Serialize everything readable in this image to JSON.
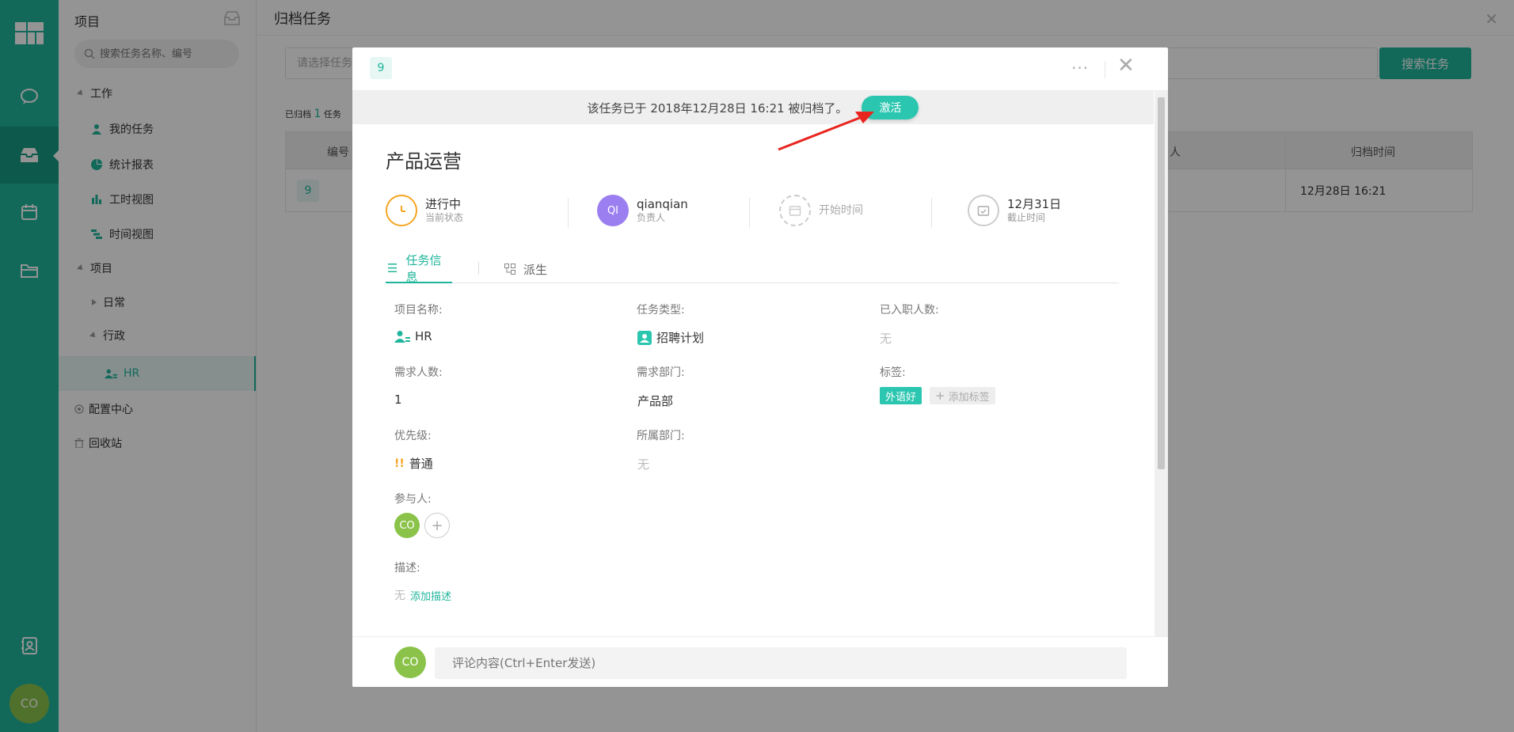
{
  "rail": {
    "avatar": "CO"
  },
  "sidebar": {
    "title": "项目",
    "search_placeholder": "搜索任务名称、编号",
    "work_group": "工作",
    "my_tasks": "我的任务",
    "stats": "统计报表",
    "hours_view": "工时视图",
    "time_view": "时间视图",
    "project_group": "项目",
    "daily": "日常",
    "admin": "行政",
    "hr": "HR",
    "config": "配置中心",
    "recycle": "回收站"
  },
  "main": {
    "title": "归档任务",
    "filter_placeholder": "请选择任务",
    "search_button": "搜索任务",
    "archived_prefix": "已归档",
    "archived_count": "1",
    "archived_suffix": "任务",
    "columns": {
      "id": "编号",
      "person": "人",
      "archived_time": "归档时间"
    },
    "row": {
      "id": "9",
      "archived_time": "12月28日 16:21"
    }
  },
  "modal": {
    "task_id": "9",
    "more": "···",
    "banner_text": "该任务已于 2018年12月28日 16:21 被归档了。",
    "activate_button": "激活",
    "title": "产品运营",
    "status": {
      "value": "进行中",
      "label": "当前状态"
    },
    "owner": {
      "initials": "QI",
      "value": "qianqian",
      "label": "负责人"
    },
    "start": {
      "label": "开始时间"
    },
    "due": {
      "value": "12月31日",
      "label": "截止时间"
    },
    "tabs": {
      "info": "任务信息",
      "derive": "派生"
    },
    "fields": {
      "project_name_label": "项目名称:",
      "project_name": "HR",
      "task_type_label": "任务类型:",
      "task_type": "招聘计划",
      "hired_label": "已入职人数:",
      "hired": "无",
      "demand_label": "需求人数:",
      "demand": "1",
      "demand_dept_label": "需求部门:",
      "demand_dept": "产品部",
      "tags_label": "标签:",
      "tag": "外语好",
      "add_tag": "添加标签",
      "priority_label": "优先级:",
      "priority_mark": "!!",
      "priority": "普通",
      "belong_dept_label": "所属部门:",
      "belong_dept": "无",
      "participants_label": "参与人:",
      "participant": "CO",
      "desc_label": "描述:",
      "desc": "无",
      "add_desc": "添加描述"
    },
    "comment": {
      "avatar": "CO",
      "placeholder": "评论内容(Ctrl+Enter发送)"
    }
  },
  "colors": {
    "accent": "#1fb59b",
    "activate": "#2bc6b0",
    "status_orange": "#f5a623",
    "owner_purple": "#9b7ff0",
    "avatar_green": "#8bc34a",
    "arrow_red": "#e8251f"
  }
}
